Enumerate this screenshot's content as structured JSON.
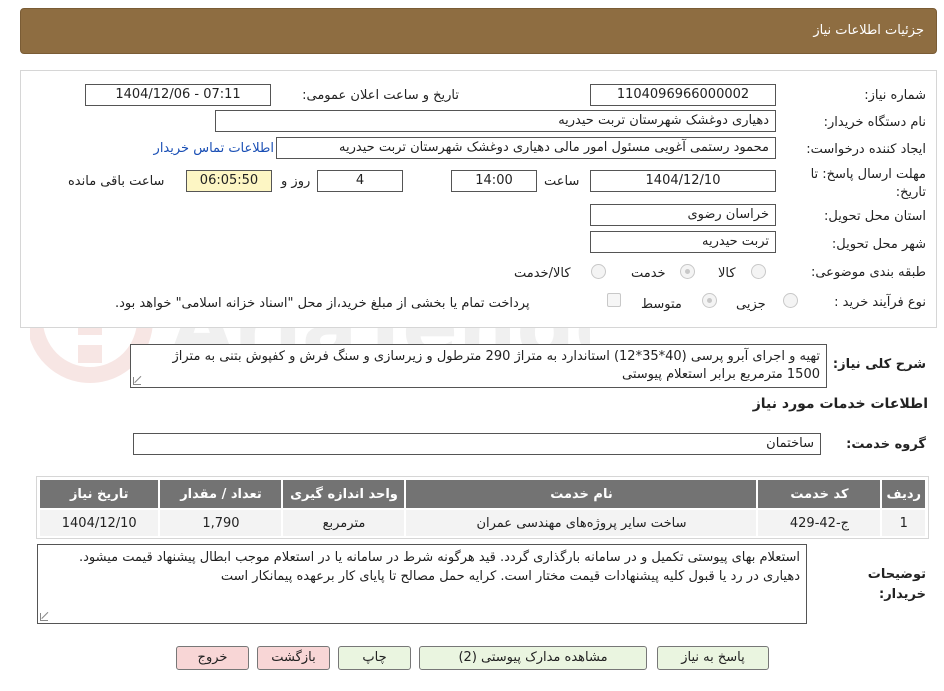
{
  "header": {
    "title": "جزئیات اطلاعات نیاز"
  },
  "form": {
    "need_number_label": "شماره نیاز:",
    "need_number": "1104096966000002",
    "announce_label": "تاریخ و ساعت اعلان عمومی:",
    "announce_value": "1404/12/06 - 07:11",
    "buyer_org_label": "نام دستگاه خریدار:",
    "buyer_org": "دهیاری دوغشک  شهرستان تربت حیدریه",
    "requester_label": "ایجاد کننده درخواست:",
    "requester": "محمود رستمی آغویی مسئول امور مالی  دهیاری دوغشک  شهرستان تربت حیدریه",
    "contact_link": "اطلاعات تماس خریدار",
    "deadline_label": "مهلت ارسال پاسخ: تا تاریخ:",
    "deadline_date": "1404/12/10",
    "time_label": "ساعت",
    "deadline_time": "14:00",
    "days_value": "4",
    "days_label": "روز و",
    "remaining_time": "06:05:50",
    "remaining_label": "ساعت باقی مانده",
    "province_label": "استان محل تحویل:",
    "province": "خراسان رضوی",
    "city_label": "شهر محل تحویل:",
    "city": "تربت حیدریه",
    "category_label": "طبقه بندی موضوعی:",
    "category_options": [
      "کالا",
      "خدمت",
      "کالا/خدمت"
    ],
    "process_label": "نوع فرآیند خرید :",
    "process_options": [
      "جزیی",
      "متوسط"
    ],
    "payment_note": "پرداخت تمام یا بخشی از مبلغ خرید،از محل \"اسناد خزانه اسلامی\" خواهد بود."
  },
  "description": {
    "label": "شرح کلی نیاز:",
    "text": "تهیه و اجرای آبرو پرسی (40*35*12) استاندارد به متراژ 290 مترطول و زیرسازی و سنگ فرش و کفپوش بتنی به متراژ 1500 مترمربع برابر استعلام پیوستی"
  },
  "services": {
    "section_title": "اطلاعات خدمات مورد نیاز",
    "group_label": "گروه خدمت:",
    "group_value": "ساختمان",
    "columns": [
      "ردیف",
      "کد خدمت",
      "نام خدمت",
      "واحد اندازه گیری",
      "تعداد / مقدار",
      "تاریخ نیاز"
    ],
    "rows": [
      [
        "1",
        "ج-42-429",
        "ساخت سایر پروژه‌های مهندسی عمران",
        "مترمربع",
        "1,790",
        "1404/12/10"
      ]
    ]
  },
  "buyer_notes": {
    "label": "توضیحات خریدار:",
    "text": "استعلام بهای پیوستی تکمیل و در سامانه بارگذاری گردد. قید هرگونه شرط در سامانه یا در استعلام موجب ابطال پیشنهاد قیمت میشود. دهیاری در رد یا قبول کلیه پیشنهادات قیمت مختار است. کرایه حمل مصالح تا پایای کار برعهده پیمانکار است"
  },
  "buttons": {
    "reply": "پاسخ به نیاز",
    "attachments": "مشاهده مدارک پیوستی (2)",
    "print": "چاپ",
    "back": "بازگشت",
    "exit": "خروج"
  },
  "colors": {
    "header_bg": "#8e6d41",
    "table_header_bg": "#737373",
    "link": "#1a4fb5"
  }
}
